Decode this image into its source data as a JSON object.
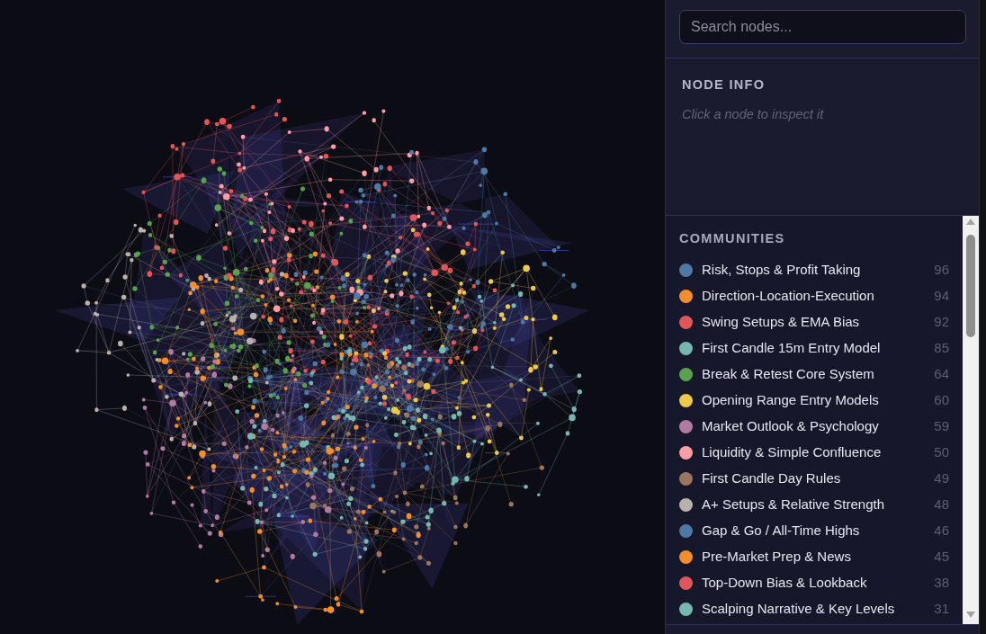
{
  "search": {
    "placeholder": "Search nodes..."
  },
  "node_info": {
    "title": "NODE INFO",
    "hint": "Click a node to inspect it"
  },
  "communities": {
    "title": "COMMUNITIES",
    "items": [
      {
        "name": "Risk, Stops & Profit Taking",
        "count": "96",
        "color": "#4e79a7"
      },
      {
        "name": "Direction-Location-Execution",
        "count": "94",
        "color": "#f28e2b"
      },
      {
        "name": "Swing Setups & EMA Bias",
        "count": "92",
        "color": "#e15759"
      },
      {
        "name": "First Candle 15m Entry Model",
        "count": "85",
        "color": "#76b7b2"
      },
      {
        "name": "Break & Retest Core System",
        "count": "64",
        "color": "#59a14f"
      },
      {
        "name": "Opening Range Entry Models",
        "count": "60",
        "color": "#edc948"
      },
      {
        "name": "Market Outlook & Psychology",
        "count": "59",
        "color": "#b07aa1"
      },
      {
        "name": "Liquidity & Simple Confluence",
        "count": "50",
        "color": "#ff9da7"
      },
      {
        "name": "First Candle Day Rules",
        "count": "49",
        "color": "#9c755f"
      },
      {
        "name": "A+ Setups & Relative Strength",
        "count": "48",
        "color": "#bab0ac"
      },
      {
        "name": "Gap & Go / All-Time Highs",
        "count": "46",
        "color": "#4e79a7"
      },
      {
        "name": "Pre-Market Prep & News",
        "count": "45",
        "color": "#f28e2b"
      },
      {
        "name": "Top-Down Bias & Lookback",
        "count": "38",
        "color": "#e15759"
      },
      {
        "name": "Scalping Narrative & Key Levels",
        "count": "31",
        "color": "#76b7b2"
      }
    ]
  }
}
